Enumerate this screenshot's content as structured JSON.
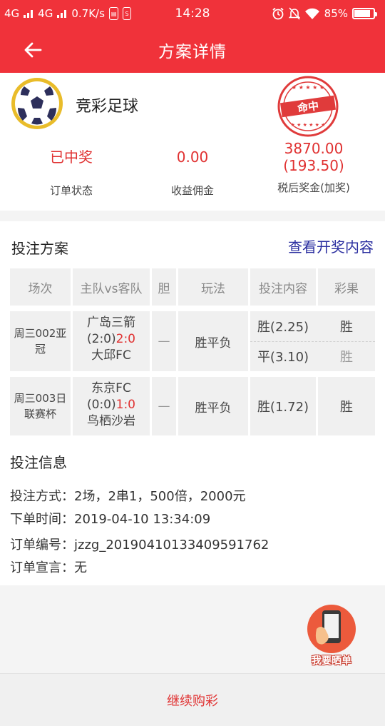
{
  "status_bar": {
    "signal1": "4G",
    "signal2": "4G",
    "speed": "0.7K/s",
    "time": "14:28",
    "battery": "85%",
    "battery_level": 0.85
  },
  "header": {
    "title": "方案详情"
  },
  "summary": {
    "game_name": "竞彩足球",
    "stamp_text": "命中",
    "stats": [
      {
        "value": "已中奖",
        "label": "订单状态"
      },
      {
        "value": "0.00",
        "label": "收益佣金"
      },
      {
        "value": "3870.00",
        "value2": "(193.50)",
        "label": "税后奖金(加奖)"
      }
    ]
  },
  "plan": {
    "title": "投注方案",
    "view_link": "查看开奖内容",
    "columns": [
      "场次",
      "主队vs客队",
      "胆",
      "玩法",
      "投注内容",
      "彩果"
    ],
    "rows": [
      {
        "match_no": "周三002亚冠",
        "home": "广岛三箭",
        "half": "(2:0)",
        "full": "2:0",
        "away": "大邱FC",
        "banker": "—",
        "play": "胜平负",
        "bets": [
          {
            "content": "胜(2.25)",
            "result": "胜"
          },
          {
            "content": "平(3.10)",
            "result": "胜"
          }
        ]
      },
      {
        "match_no": "周三003日联赛杯",
        "home": "东京FC",
        "half": "(0:0)",
        "full": "1:0",
        "away": "鸟栖沙岩",
        "banker": "—",
        "play": "胜平负",
        "bets": [
          {
            "content": "胜(1.72)",
            "result": "胜"
          }
        ]
      }
    ]
  },
  "bet_info": {
    "title": "投注信息",
    "lines": [
      "投注方式：2场，2串1，500倍，2000元",
      "下单时间：2019-04-10 13:34:09",
      "订单编号：jzzg_20190410133409591762",
      "订单宣言：无"
    ]
  },
  "share_button": {
    "label": "我要晒单"
  },
  "bottom_bar": {
    "label": "继续购彩"
  },
  "colors": {
    "brand_red": "#f0323a",
    "win_red": "#e03131",
    "link_blue": "#2b2fa0"
  }
}
